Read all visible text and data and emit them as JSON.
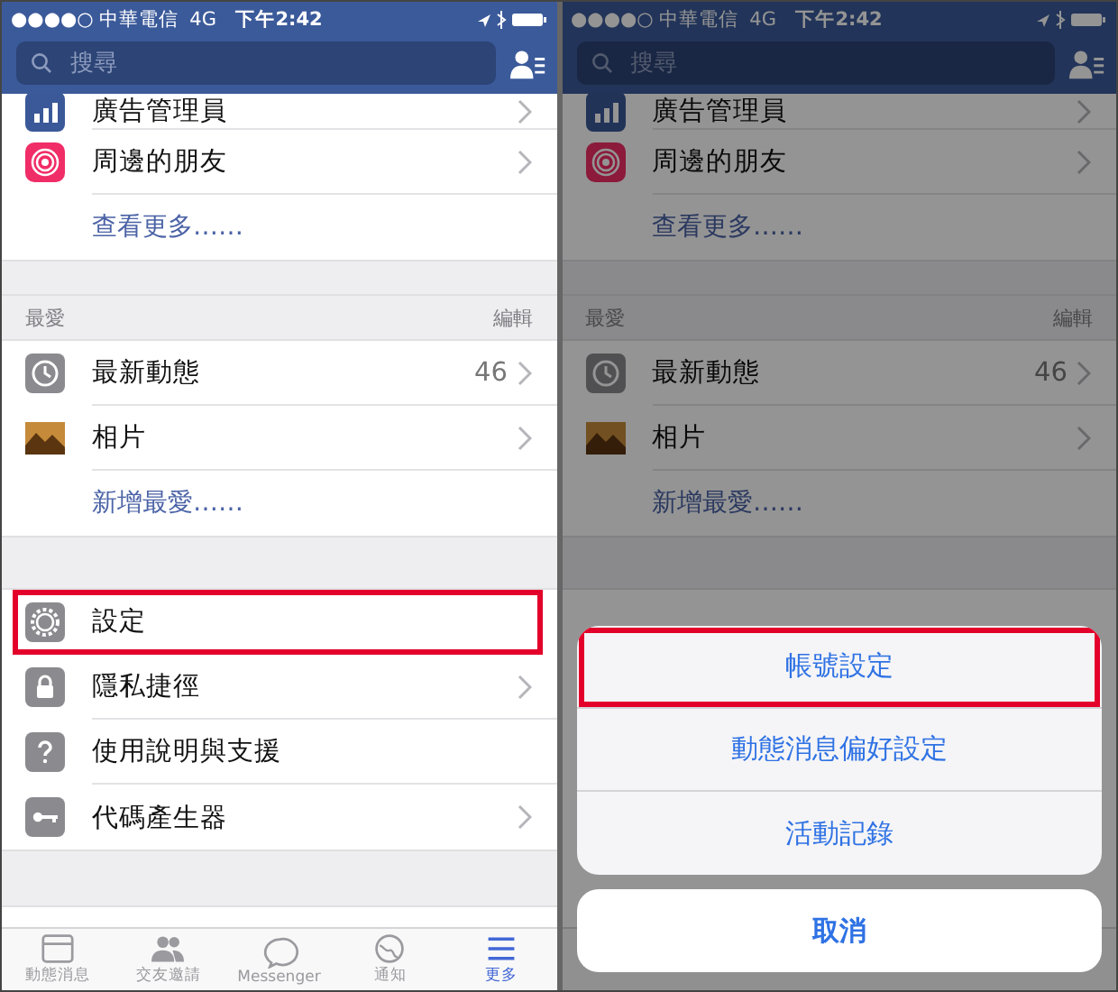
{
  "screens": [
    {
      "status_bar": {
        "carrier": "●●●●○ 中華電信",
        "network": "4G",
        "time": "下午2:42"
      },
      "search": {
        "placeholder": "搜尋"
      },
      "sections": [
        {
          "rows": [
            {
              "kind": "item",
              "label": "廣告管理員",
              "chevron": true,
              "highlighted": false
            },
            {
              "kind": "item",
              "label": "周邊的朋友",
              "chevron": true,
              "highlighted": false
            },
            {
              "kind": "link",
              "label": "查看更多……"
            }
          ]
        },
        {
          "header": {
            "title": "最愛",
            "action": "編輯"
          },
          "rows": [
            {
              "kind": "item",
              "label": "最新動態",
              "count": "46",
              "chevron": true,
              "highlighted": false
            },
            {
              "kind": "item",
              "label": "相片",
              "chevron": true,
              "highlighted": false
            },
            {
              "kind": "link",
              "label": "新增最愛……"
            }
          ]
        },
        {
          "rows": [
            {
              "kind": "item",
              "label": "設定",
              "chevron": false,
              "highlighted": true
            },
            {
              "kind": "item",
              "label": "隱私捷徑",
              "chevron": true,
              "highlighted": false
            },
            {
              "kind": "item",
              "label": "使用說明與支援",
              "chevron": false,
              "highlighted": false
            },
            {
              "kind": "item",
              "label": "代碼產生器",
              "chevron": true,
              "highlighted": false
            }
          ]
        }
      ],
      "tabs": [
        {
          "label": "動態消息",
          "selected": false
        },
        {
          "label": "交友邀請",
          "selected": false
        },
        {
          "label": "Messenger",
          "selected": false
        },
        {
          "label": "通知",
          "selected": false
        },
        {
          "label": "更多",
          "selected": true
        }
      ]
    },
    {
      "status_bar": {
        "carrier": "●●●●○ 中華電信",
        "network": "4G",
        "time": "下午2:42"
      },
      "search": {
        "placeholder": "搜尋"
      },
      "sections": [
        {
          "rows": [
            {
              "kind": "item",
              "label": "廣告管理員",
              "chevron": true,
              "highlighted": false
            },
            {
              "kind": "item",
              "label": "周邊的朋友",
              "chevron": true,
              "highlighted": false
            },
            {
              "kind": "link",
              "label": "查看更多……"
            }
          ]
        },
        {
          "header": {
            "title": "最愛",
            "action": "編輯"
          },
          "rows": [
            {
              "kind": "item",
              "label": "最新動態",
              "count": "46",
              "chevron": true,
              "highlighted": false
            },
            {
              "kind": "item",
              "label": "相片",
              "chevron": true,
              "highlighted": false
            },
            {
              "kind": "link",
              "label": "新增最愛……"
            }
          ]
        }
      ],
      "action_sheet": {
        "options": [
          {
            "label": "帳號設定",
            "highlighted": true
          },
          {
            "label": "動態消息偏好設定",
            "highlighted": false
          },
          {
            "label": "活動記錄",
            "highlighted": false
          }
        ],
        "cancel": "取消"
      }
    }
  ]
}
